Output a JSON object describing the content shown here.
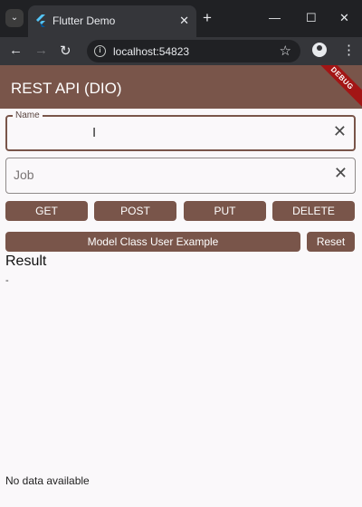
{
  "browser": {
    "tab_title": "Flutter Demo",
    "url": "localhost:54823"
  },
  "app": {
    "title": "REST API (DIO)",
    "debug_banner": "DEBUG",
    "name_field": {
      "label": "Name",
      "value": ""
    },
    "job_field": {
      "placeholder": "Job",
      "value": ""
    },
    "buttons": {
      "get": "GET",
      "post": "POST",
      "put": "PUT",
      "delete": "DELETE",
      "model_example": "Model Class User Example",
      "reset": "Reset"
    },
    "result_heading": "Result",
    "result_value": "-",
    "footer": "No data available"
  },
  "colors": {
    "primary": "#79554a",
    "background": "#faf8fa",
    "debug": "#a31515"
  },
  "icons": [
    "tab-search-icon",
    "flutter-icon",
    "close-icon",
    "plus-icon",
    "minimize-icon",
    "maximize-icon",
    "back-icon",
    "forward-icon",
    "reload-icon",
    "info-icon",
    "star-icon",
    "profile-icon",
    "menu-icon",
    "clear-icon"
  ]
}
